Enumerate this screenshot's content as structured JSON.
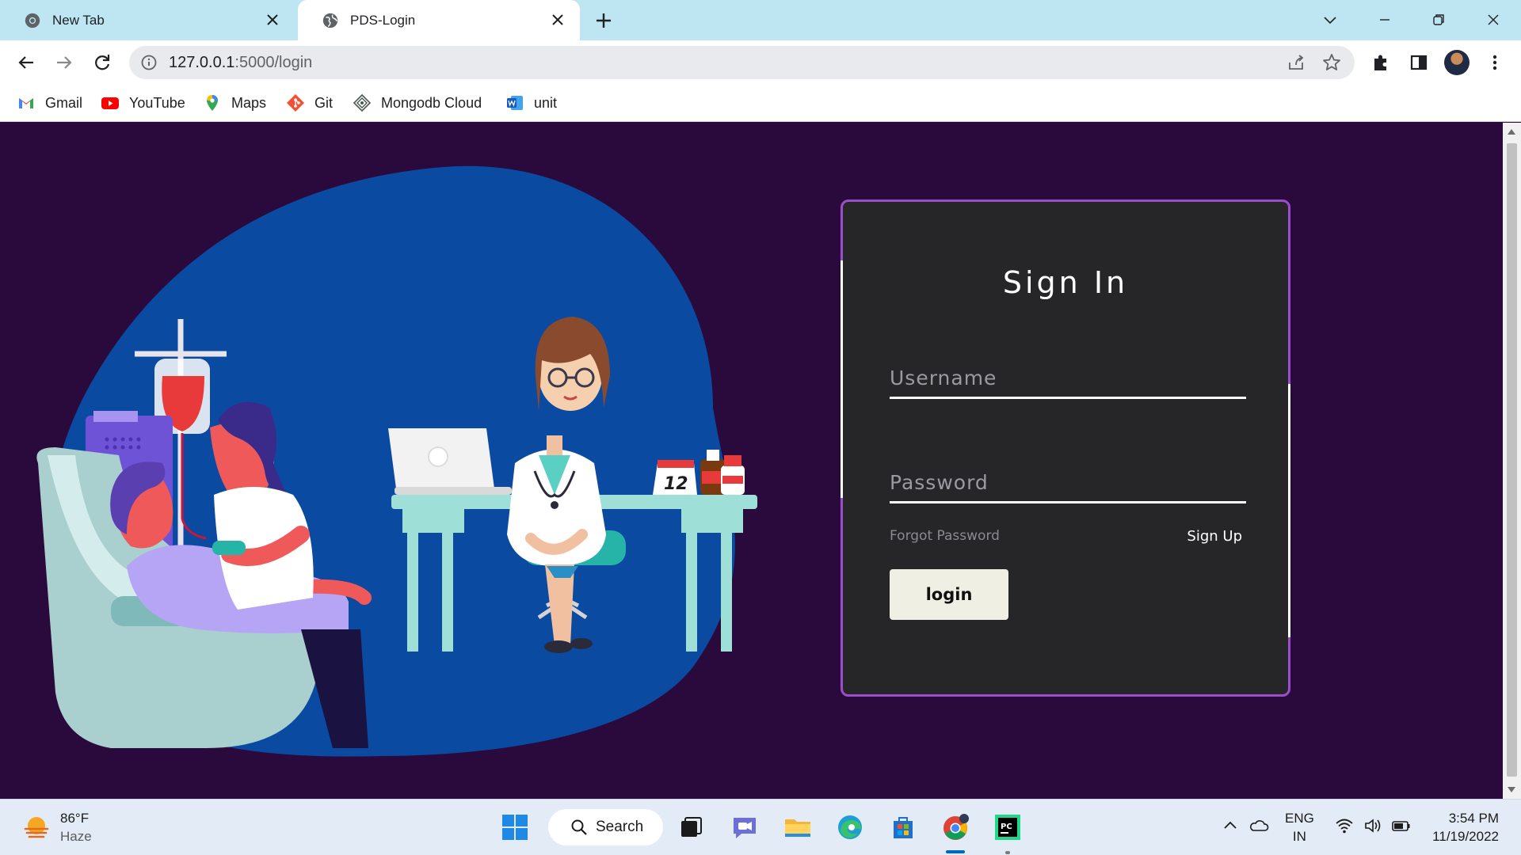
{
  "browser": {
    "tabs": [
      {
        "title": "New Tab",
        "active": false
      },
      {
        "title": "PDS-Login",
        "active": true
      }
    ],
    "url_host": "127.0.0.1",
    "url_rest": ":5000/login",
    "bookmarks": [
      {
        "label": "Gmail",
        "icon": "gmail-icon"
      },
      {
        "label": "YouTube",
        "icon": "youtube-icon"
      },
      {
        "label": "Maps",
        "icon": "maps-icon"
      },
      {
        "label": "Git",
        "icon": "git-icon"
      },
      {
        "label": "Mongodb Cloud",
        "icon": "mongodb-icon"
      },
      {
        "label": "unit",
        "icon": "word-icon"
      }
    ]
  },
  "login": {
    "title": "Sign In",
    "username_placeholder": "Username",
    "password_placeholder": "Password",
    "forgot_label": "Forgot Password",
    "signup_label": "Sign Up",
    "login_label": "login"
  },
  "taskbar": {
    "weather_temp": "86°F",
    "weather_desc": "Haze",
    "search_label": "Search",
    "lang_line1": "ENG",
    "lang_line2": "IN",
    "time": "3:54 PM",
    "date": "11/19/2022"
  },
  "colors": {
    "page_bg": "#2a0a3c",
    "card_bg": "#262629",
    "card_border": "#9b4dca",
    "blob": "#0a4aa0",
    "login_button_bg": "#efefe3"
  }
}
